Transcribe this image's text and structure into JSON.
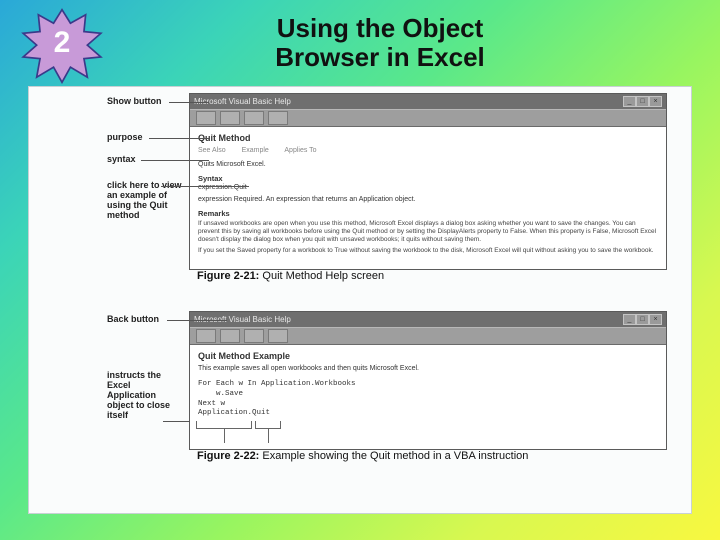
{
  "badge_number": "2",
  "title_line1": "Using the Object",
  "title_line2": "Browser in Excel",
  "fig1": {
    "win_title": "Microsoft Visual Basic Help",
    "heading": "Quit Method",
    "links": {
      "see_also": "See Also",
      "example": "Example",
      "applies": "Applies To"
    },
    "summary": "Quits Microsoft Excel.",
    "syntax_label": "Syntax",
    "syntax_expr": "expression.Quit",
    "syntax_desc": "expression   Required. An expression that returns an Application object.",
    "remarks_label": "Remarks",
    "remarks_p1": "If unsaved workbooks are open when you use this method, Microsoft Excel displays a dialog box asking whether you want to save the changes. You can prevent this by saving all workbooks before using the Quit method or by setting the DisplayAlerts property to False. When this property is False, Microsoft Excel doesn't display the dialog box when you quit with unsaved workbooks; it quits without saving them.",
    "remarks_p2": "If you set the Saved property for a workbook to True without saving the workbook to the disk, Microsoft Excel will quit without asking you to save the workbook.",
    "callouts": {
      "show": "Show button",
      "purpose": "purpose",
      "syntax": "syntax",
      "example": "click here to view an example of using the Quit method"
    },
    "caption_label": "Figure 2-21:",
    "caption_text": "Quit Method Help screen"
  },
  "fig2": {
    "win_title": "Microsoft Visual Basic Help",
    "heading": "Quit Method Example",
    "intro": "This example saves all open workbooks and then quits Microsoft Excel.",
    "code": "For Each w In Application.Workbooks\n    w.Save\nNext w\nApplication.Quit",
    "callouts": {
      "back": "Back button",
      "instructs": "instructs the Excel Application object to close itself"
    },
    "caption_label": "Figure 2-22:",
    "caption_text": "Example showing the Quit method in a VBA instruction"
  }
}
